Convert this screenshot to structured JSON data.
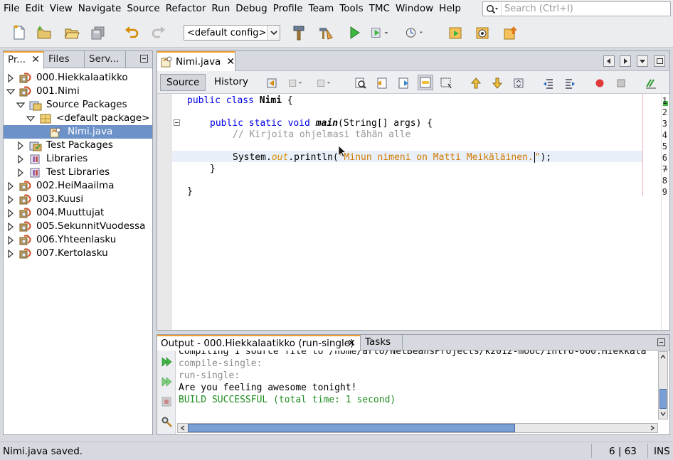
{
  "menubar": {
    "items": [
      "File",
      "Edit",
      "View",
      "Navigate",
      "Source",
      "Refactor",
      "Run",
      "Debug",
      "Profile",
      "Team",
      "Tools",
      "TMC",
      "Window",
      "Help"
    ],
    "search_placeholder": "Search (Ctrl+I)"
  },
  "toolbar": {
    "config_value": "<default config>"
  },
  "left_panel": {
    "tabs": [
      "Pr...",
      "Files",
      "Serv..."
    ],
    "tree": [
      {
        "label": "000.Hiekkalaatikko",
        "level": 0,
        "icon": "project-icon",
        "expanded": false
      },
      {
        "label": "001.Nimi",
        "level": 0,
        "icon": "project-icon",
        "expanded": true
      },
      {
        "label": "Source Packages",
        "level": 1,
        "icon": "source-packages-icon",
        "expanded": true
      },
      {
        "label": "<default package>",
        "level": 2,
        "icon": "package-icon",
        "expanded": true
      },
      {
        "label": "Nimi.java",
        "level": 3,
        "icon": "java-file-icon",
        "selected": true
      },
      {
        "label": "Test Packages",
        "level": 1,
        "icon": "test-packages-icon",
        "expanded": false
      },
      {
        "label": "Libraries",
        "level": 1,
        "icon": "libraries-icon",
        "expanded": false
      },
      {
        "label": "Test Libraries",
        "level": 1,
        "icon": "libraries-icon",
        "expanded": false
      },
      {
        "label": "002.HeiMaailma",
        "level": 0,
        "icon": "project-icon",
        "expanded": false
      },
      {
        "label": "003.Kuusi",
        "level": 0,
        "icon": "project-icon",
        "expanded": false
      },
      {
        "label": "004.Muuttujat",
        "level": 0,
        "icon": "project-icon",
        "expanded": false
      },
      {
        "label": "005.SekunnitVuodessa",
        "level": 0,
        "icon": "project-icon",
        "expanded": false
      },
      {
        "label": "006.Yhteenlasku",
        "level": 0,
        "icon": "project-icon",
        "expanded": false
      },
      {
        "label": "007.Kertolasku",
        "level": 0,
        "icon": "project-icon",
        "expanded": false
      }
    ]
  },
  "editor": {
    "tab_label": "Nimi.java",
    "source_label": "Source",
    "history_label": "History",
    "line_numbers": [
      "1",
      "2",
      "3",
      "4",
      "5",
      "6",
      "7",
      "8",
      "9"
    ],
    "code": {
      "l1_kw": "public class ",
      "l1_name": "Nimi",
      "l1_rest": " {",
      "l3_kw": "public static void ",
      "l3_fn": "main",
      "l3_rest": "(String[] args) {",
      "l4_comment": "// Kirjoita ohjelmasi tähän alle",
      "l6_a": "System.",
      "l6_out": "out",
      "l6_b": ".println(",
      "l6_str": "\"Minun nimeni on Matti Meikäläinen.",
      "l6_q": "\"",
      "l6_c": ");",
      "l7": "}",
      "l9": "}"
    }
  },
  "output": {
    "tab_label": "Output - 000.Hiekkalaatikko (run-single)",
    "tasks_label": "Tasks",
    "lines": [
      {
        "text": "Compiling 1 source file to /home/arto/NetBeansProjects/k2012-mooc/intro-000.Hiekkala",
        "color": "#000000"
      },
      {
        "text": "compile-single:",
        "color": "#8a8a8a"
      },
      {
        "text": "run-single:",
        "color": "#8a8a8a"
      },
      {
        "text": "Are you feeling awesome tonight!",
        "color": "#000000"
      },
      {
        "text": "BUILD SUCCESSFUL (total time: 1 second)",
        "color": "#1e8c1e"
      }
    ]
  },
  "statusbar": {
    "message": "Nimi.java saved.",
    "position": "6 | 63",
    "mode": "INS"
  },
  "colors": {
    "accent_tab": "#f29a2e",
    "selection": "#6c92c9"
  }
}
